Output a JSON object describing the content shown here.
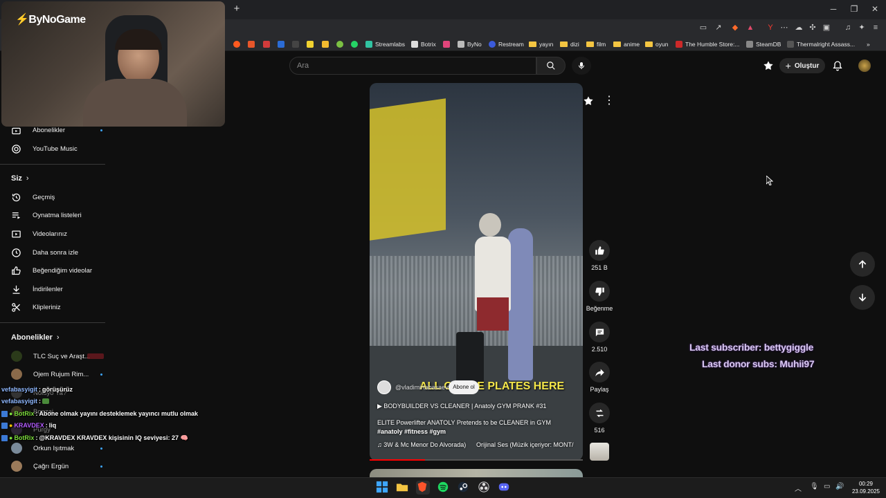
{
  "browser": {
    "new_tab": "+",
    "bookmarks": [
      "Streamlabs",
      "Botrix",
      "ByNo",
      "Restream",
      "yayın",
      "dizi",
      "film",
      "anime",
      "oyun",
      "The Humble Store:...",
      "SteamDB",
      "Thermalright Assass..."
    ],
    "more_bookmarks": "»"
  },
  "youtube": {
    "search_placeholder": "Ara",
    "create_label": "Oluştur"
  },
  "webcam": {
    "logo": "ByNoGame"
  },
  "sidebar": {
    "subscriptions_item": "Abonelikler",
    "music_item": "YouTube Music",
    "you_section": "Siz",
    "you_items": [
      "Geçmiş",
      "Oynatma listeleri",
      "Videolarınız",
      "Daha sonra izle",
      "Beğendiğim videolar",
      "İndirilenler",
      "Klipleriniz"
    ],
    "subs_section": "Abonelikler",
    "channels": [
      "TLC Suç ve Araşt...",
      "Ojem Rujum Rim...",
      "Noluyo Ya?",
      "Bonzai",
      "Purgy",
      "Orkun Işıtmak",
      "Çağrı Ergün"
    ]
  },
  "video": {
    "channel": "@vladimirtabasaev",
    "subscribe": "Abone ol",
    "caption_overlay": "ALL OF THE PLATES HERE",
    "related": "BODYBUILDER VS CLEANER | Anatoly GYM PRANK #31",
    "title": "ELITE Powerlifter ANATOLY Pretends to be CLEANER in GYM",
    "hashtags": "#anatoly #fitness #gym",
    "music_left": "3W & Mc Menor Do Alvorada)",
    "music_right": "Orijinal Ses (Müzik içeriyor: MONT/",
    "progress_fraction": 0.26
  },
  "actions": {
    "like_count": "251 B",
    "dislike_label": "Beğenme",
    "comment_count": "2.510",
    "share_label": "Paylaş",
    "remix_count": "516"
  },
  "overlay": {
    "last_subscriber": "Last subscriber: bettygiggle",
    "last_donor": "Last donor subs: Muhii97"
  },
  "chat": [
    {
      "user": "vefabasyigit",
      "message": "görüşürüz"
    },
    {
      "user": "vefabasyigit",
      "message": ""
    },
    {
      "user": "BotRix",
      "message": "Abone olmak yayını desteklemek yayıncı mutlu olmak"
    },
    {
      "user": "KRAVDEX",
      "message": "liq"
    },
    {
      "user": "BotRix",
      "message": "@KRAVDEX KRAVDEX kişisinin IQ seviyesi: 27 🧠"
    }
  ],
  "taskbar": {
    "time": "00:29",
    "date": "23.09.2025"
  },
  "colors": {
    "background": "#0f0f0f",
    "accent_red": "#ff0000",
    "link_blue": "#3ea6ff",
    "botrix_green": "#7ddc3c",
    "kravdex_purple": "#b45cff"
  }
}
